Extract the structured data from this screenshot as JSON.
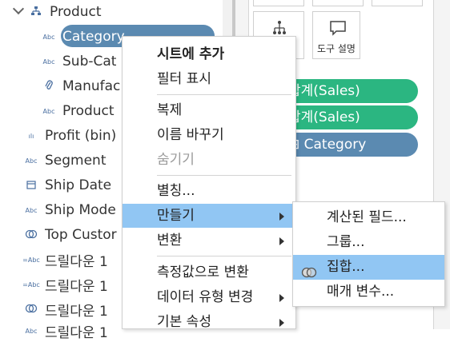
{
  "data_pane": {
    "folder": {
      "label": "Product",
      "icon": "hierarchy-icon"
    },
    "fields": [
      {
        "label": "Category",
        "icon": "abc-icon",
        "icon_text": "Abc",
        "selected": true
      },
      {
        "label": "Sub-Cat",
        "icon": "abc-icon",
        "icon_text": "Abc"
      },
      {
        "label": "Manufac",
        "icon": "paperclip-icon",
        "icon_text": "⌀"
      },
      {
        "label": "Product",
        "icon": "abc-icon",
        "icon_text": "Abc"
      },
      {
        "label": "Profit (bin)",
        "icon": "bin-icon",
        "icon_text": "ılı"
      },
      {
        "label": "Segment",
        "icon": "abc-icon",
        "icon_text": "Abc"
      },
      {
        "label": "Ship Date",
        "icon": "calendar-icon",
        "icon_text": "▤"
      },
      {
        "label": "Ship Mode",
        "icon": "abc-icon",
        "icon_text": "Abc"
      },
      {
        "label": "Top Custor",
        "icon": "set-icon",
        "icon_text": "◎"
      },
      {
        "label": "드릴다운 1",
        "icon": "abc-icon",
        "icon_text": "=Abc"
      },
      {
        "label": "드릴다운 1",
        "icon": "abc-icon",
        "icon_text": "=Abc"
      },
      {
        "label": "드릴다운 1",
        "icon": "set-icon",
        "icon_text": "◎"
      },
      {
        "label": "드릴다운 1",
        "icon": "abc-icon",
        "icon_text": "Abc"
      }
    ]
  },
  "marks": {
    "detail_label": "부",
    "tooltip_label": "도구 설명",
    "pills": [
      {
        "label": "합계(Sales)",
        "color": "#2bb681"
      },
      {
        "label": "합계(Sales)",
        "color": "#2bb681"
      },
      {
        "label": "⊞ Category",
        "color": "#5b8ab1"
      }
    ]
  },
  "context_menu": {
    "items": [
      {
        "label": "시트에 추가",
        "bold": true
      },
      {
        "label": "필터 표시"
      },
      {
        "label": "복제"
      },
      {
        "label": "이름 바꾸기"
      },
      {
        "label": "숨기기",
        "disabled": true
      },
      {
        "label": "별칭..."
      },
      {
        "label": "만들기",
        "submenu": true,
        "highlighted": true
      },
      {
        "label": "변환",
        "submenu": true
      },
      {
        "label": "측정값으로 변환"
      },
      {
        "label": "데이터 유형 변경",
        "submenu": true
      },
      {
        "label": "기본 속성",
        "submenu": true
      }
    ]
  },
  "submenu": {
    "items": [
      {
        "label": "계산된 필드..."
      },
      {
        "label": "그룹..."
      },
      {
        "label": "집합...",
        "highlighted": true,
        "icon": "set-icon"
      },
      {
        "label": "매개 변수..."
      }
    ]
  },
  "colors": {
    "highlight": "#91c6f3",
    "pill_blue": "#5b8ab1",
    "pill_green": "#2bb681"
  }
}
